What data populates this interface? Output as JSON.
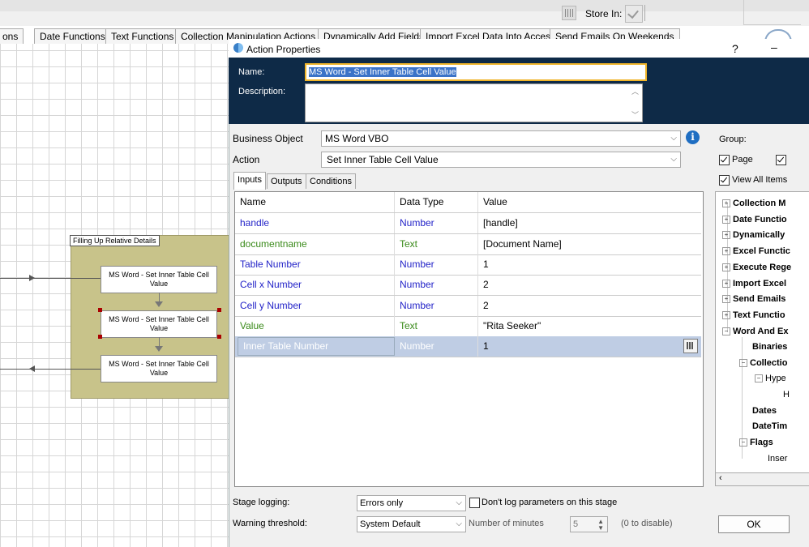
{
  "top": {
    "store_label": "Store In:"
  },
  "tabs": [
    "ons",
    "Date Functions",
    "Text Functions",
    "Collection Manipulation Actions",
    "Dynamically Add Fields",
    "Import Excel Data Into Access",
    "Send Emails On Weekends"
  ],
  "canvas": {
    "block_label": "Filling Up Relative Details",
    "stages": [
      "MS Word - Set Inner Table Cell Value",
      "MS Word - Set Inner Table Cell Value",
      "MS Word - Set Inner Table Cell Value"
    ]
  },
  "dialog": {
    "title": "Action Properties",
    "help": "?",
    "minimize": "–",
    "name_label": "Name:",
    "name_value": "MS Word - Set Inner Table Cell Value",
    "description_label": "Description:",
    "business_object_label": "Business Object",
    "business_object_value": "MS Word VBO",
    "action_label": "Action",
    "action_value": "Set Inner Table Cell Value",
    "info": "i",
    "inner_tabs": [
      "Inputs",
      "Outputs",
      "Conditions"
    ],
    "grid": {
      "headers": [
        "Name",
        "Data Type",
        "Value"
      ],
      "rows": [
        {
          "name": "handle",
          "type": "Number",
          "value": "[handle]",
          "color": "#2323c8"
        },
        {
          "name": "documentname",
          "type": "Text",
          "value": "[Document Name]",
          "color": "#3a8a1a"
        },
        {
          "name": "Table Number",
          "type": "Number",
          "value": "1",
          "color": "#2323c8"
        },
        {
          "name": "Cell x Number",
          "type": "Number",
          "value": "2",
          "color": "#2323c8"
        },
        {
          "name": "Cell y Number",
          "type": "Number",
          "value": "2",
          "color": "#2323c8"
        },
        {
          "name": "Value",
          "type": "Text",
          "value": "\"Rita Seeker\"",
          "color": "#3a8a1a"
        },
        {
          "name": "Inner Table Number",
          "type": "Number",
          "value": "1",
          "color": "#ffffff"
        }
      ]
    },
    "stage_logging_label": "Stage logging:",
    "stage_logging_value": "Errors only",
    "dont_log_label": "Don't log parameters on this stage",
    "warning_label": "Warning threshold:",
    "warning_value": "System Default",
    "minutes_label": "Number of minutes",
    "minutes_value": "5",
    "disable_hint": "(0 to disable)",
    "ok": "OK"
  },
  "right_panel": {
    "group_label": "Group:",
    "page_label": "Page",
    "view_all_label": "View All Items",
    "tree": [
      {
        "label": "Collection M",
        "level": 0,
        "exp": "+"
      },
      {
        "label": "Date Functio",
        "level": 0,
        "exp": "+"
      },
      {
        "label": "Dynamically",
        "level": 0,
        "exp": "+"
      },
      {
        "label": "Excel Functic",
        "level": 0,
        "exp": "+"
      },
      {
        "label": "Execute Rege",
        "level": 0,
        "exp": "+"
      },
      {
        "label": "Import Excel",
        "level": 0,
        "exp": "+"
      },
      {
        "label": "Send Emails",
        "level": 0,
        "exp": "+"
      },
      {
        "label": "Text Functio",
        "level": 0,
        "exp": "+"
      },
      {
        "label": "Word And Ex",
        "level": 0,
        "exp": "-"
      },
      {
        "label": "Binaries",
        "level": 1,
        "exp": ""
      },
      {
        "label": "Collectio",
        "level": 1,
        "exp": "-"
      },
      {
        "label": "Hype",
        "level": 2,
        "exp": "-"
      },
      {
        "label": "H",
        "level": 3,
        "exp": ""
      },
      {
        "label": "Dates",
        "level": 1,
        "exp": ""
      },
      {
        "label": "DateTim",
        "level": 1,
        "exp": ""
      },
      {
        "label": "Flags",
        "level": 1,
        "exp": "-"
      },
      {
        "label": "Inser",
        "level": 2,
        "exp": ""
      }
    ]
  }
}
